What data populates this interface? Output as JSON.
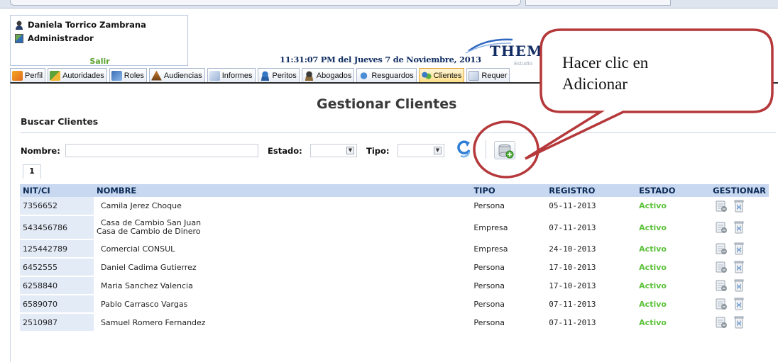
{
  "user": {
    "name": "Daniela Torrico Zambrana",
    "role": "Administrador",
    "logout_label": "Salir"
  },
  "header": {
    "clock": "11:31:07 PM del Jueves 7 de Noviembre, 2013",
    "logo_text": "THEM",
    "logo_subtitle": "Estudio"
  },
  "tabs": [
    {
      "label": "Perfil",
      "icon": "profile-icon"
    },
    {
      "label": "Autoridades",
      "icon": "authorities-icon"
    },
    {
      "label": "Roles",
      "icon": "roles-icon"
    },
    {
      "label": "Audiencias",
      "icon": "hearings-icon"
    },
    {
      "label": "Informes",
      "icon": "reports-icon"
    },
    {
      "label": "Peritos",
      "icon": "experts-icon"
    },
    {
      "label": "Abogados",
      "icon": "lawyers-icon"
    },
    {
      "label": "Resguardos",
      "icon": "safeguards-icon"
    },
    {
      "label": "Clientes",
      "icon": "clients-icon",
      "active": true
    },
    {
      "label": "Requer",
      "icon": "requirements-icon"
    }
  ],
  "page": {
    "title": "Gestionar Clientes",
    "section_title": "Buscar Clientes"
  },
  "search": {
    "name_label": "Nombre:",
    "name_value": "",
    "status_label": "Estado:",
    "status_value": "",
    "type_label": "Tipo:",
    "type_value": ""
  },
  "pagination": {
    "current": "1"
  },
  "table": {
    "headers": [
      "NIT/CI",
      "NOMBRE",
      "TIPO",
      "REGISTRO",
      "ESTADO",
      "GESTIONAR"
    ],
    "rows": [
      {
        "nit": "7356652",
        "name": "Camila Jerez Choque",
        "type": "Persona",
        "date": "05-11-2013",
        "status": "Activo"
      },
      {
        "nit": "543456786",
        "name": "Casa de Cambio San Juan",
        "name2": "Casa de Cambio de Dinero",
        "type": "Empresa",
        "date": "07-11-2013",
        "status": "Activo"
      },
      {
        "nit": "125442789",
        "name": "Comercial CONSUL",
        "type": "Empresa",
        "date": "24-10-2013",
        "status": "Activo"
      },
      {
        "nit": "6452555",
        "name": "Daniel Cadima Gutierrez",
        "type": "Persona",
        "date": "17-10-2013",
        "status": "Activo"
      },
      {
        "nit": "6258840",
        "name": "Maria Sanchez Valencia",
        "type": "Persona",
        "date": "17-10-2013",
        "status": "Activo"
      },
      {
        "nit": "6589070",
        "name": "Pablo Carrasco Vargas",
        "type": "Persona",
        "date": "07-11-2013",
        "status": "Activo"
      },
      {
        "nit": "2510987",
        "name": "Samuel Romero Fernandez",
        "type": "Persona",
        "date": "07-11-2013",
        "status": "Activo"
      }
    ]
  },
  "callout": {
    "line1": "Hacer clic en",
    "line2": "Adicionar"
  },
  "colors": {
    "status_active": "#5cc23a",
    "header_blue": "#c8d8f0",
    "callout_red": "#b5383a"
  }
}
